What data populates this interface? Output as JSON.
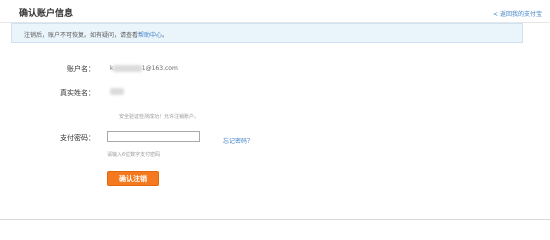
{
  "header": {
    "title": "确认账户信息",
    "back_chevron": "<",
    "back_link": "返回我的支付宝"
  },
  "notice": {
    "text_before": "注销后，账户不可恢复。如有疑问，请查看",
    "link": "帮助中心",
    "text_after": "。"
  },
  "account": {
    "label": "账户名：",
    "value_prefix": "k",
    "value_masked": "••••••••",
    "value_suffix": "1@163.com"
  },
  "realname": {
    "label": "真实姓名：",
    "value_masked": "••••"
  },
  "hint": {
    "text": "安全验证检测成功！允许注销账户。"
  },
  "password": {
    "label": "支付密码：",
    "value": "",
    "forgot_link": "忘记密码？",
    "hint": "请输入6位数字支付密码"
  },
  "confirm_button": {
    "label": "确认注销"
  },
  "colors": {
    "accent": "#3f82c6",
    "button": "#f57a1f",
    "notice_bg": "#eaf4fb"
  }
}
